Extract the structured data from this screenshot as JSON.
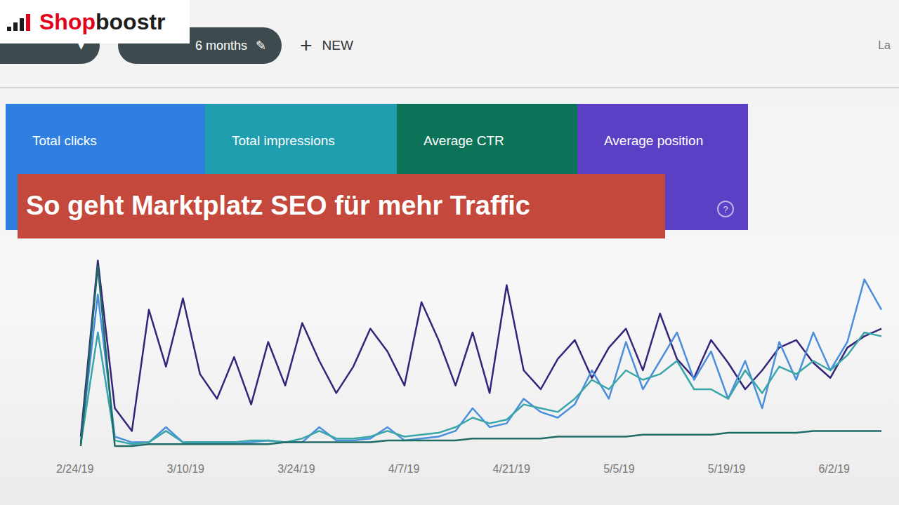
{
  "logo": {
    "parts": [
      {
        "text": "Shop",
        "color": "#e3001b"
      },
      {
        "text": "boostr",
        "color": "#1d1d1d"
      }
    ]
  },
  "toolbar": {
    "chips": [
      {
        "label": "",
        "icon": "▾"
      },
      {
        "label": "6 months",
        "icon": "✎"
      }
    ],
    "new_button": {
      "icon": "+",
      "label": "NEW"
    },
    "right_text": "La"
  },
  "metrics": [
    {
      "label": "Total clicks",
      "selected": true,
      "color": "#2f7fe0"
    },
    {
      "label": "Total impressions",
      "selected": true,
      "color": "#1f9eb0"
    },
    {
      "label": "Average CTR",
      "selected": true,
      "color": "#0d7358"
    },
    {
      "label": "Average position",
      "selected": true,
      "color": "#5b3fc4",
      "help_icon": "?"
    }
  ],
  "title_overlay": {
    "text": "So geht Marktplatz SEO für mehr Traffic"
  },
  "chart": {
    "x_ticks": [
      "2/24/19",
      "3/10/19",
      "3/24/19",
      "4/7/19",
      "4/21/19",
      "5/5/19",
      "5/19/19",
      "6/2/19"
    ],
    "series": [
      {
        "name": "position",
        "color": "#35257a",
        "values": [
          5,
          98,
          20,
          8,
          72,
          42,
          78,
          38,
          25,
          47,
          22,
          55,
          32,
          65,
          45,
          28,
          42,
          62,
          50,
          32,
          76,
          56,
          32,
          60,
          28,
          85,
          40,
          30,
          46,
          56,
          36,
          52,
          62,
          40,
          70,
          46,
          36,
          56,
          44,
          30,
          40,
          52,
          56,
          44,
          36,
          52,
          58,
          62
        ]
      },
      {
        "name": "clicks",
        "color": "#4a8fdc",
        "values": [
          2,
          80,
          5,
          2,
          2,
          10,
          2,
          2,
          2,
          2,
          2,
          3,
          2,
          2,
          10,
          3,
          3,
          4,
          10,
          3,
          4,
          5,
          8,
          20,
          10,
          12,
          25,
          18,
          15,
          22,
          40,
          25,
          55,
          30,
          45,
          60,
          35,
          50,
          25,
          45,
          20,
          55,
          35,
          60,
          40,
          55,
          88,
          72
        ]
      },
      {
        "name": "impressions",
        "color": "#3aa6a8",
        "values": [
          1,
          60,
          3,
          1,
          2,
          8,
          2,
          2,
          2,
          2,
          3,
          3,
          2,
          4,
          8,
          4,
          4,
          5,
          8,
          5,
          6,
          7,
          10,
          15,
          12,
          14,
          22,
          20,
          18,
          25,
          35,
          30,
          40,
          35,
          38,
          45,
          30,
          30,
          25,
          40,
          28,
          42,
          38,
          45,
          40,
          48,
          60,
          58
        ]
      },
      {
        "name": "ctr",
        "color": "#1f6b66",
        "values": [
          0,
          95,
          0,
          0,
          1,
          1,
          1,
          1,
          1,
          1,
          1,
          1,
          2,
          2,
          2,
          2,
          2,
          2,
          3,
          3,
          3,
          3,
          3,
          4,
          4,
          4,
          4,
          4,
          5,
          5,
          5,
          5,
          5,
          6,
          6,
          6,
          6,
          6,
          7,
          7,
          7,
          7,
          7,
          8,
          8,
          8,
          8,
          8
        ]
      }
    ]
  }
}
